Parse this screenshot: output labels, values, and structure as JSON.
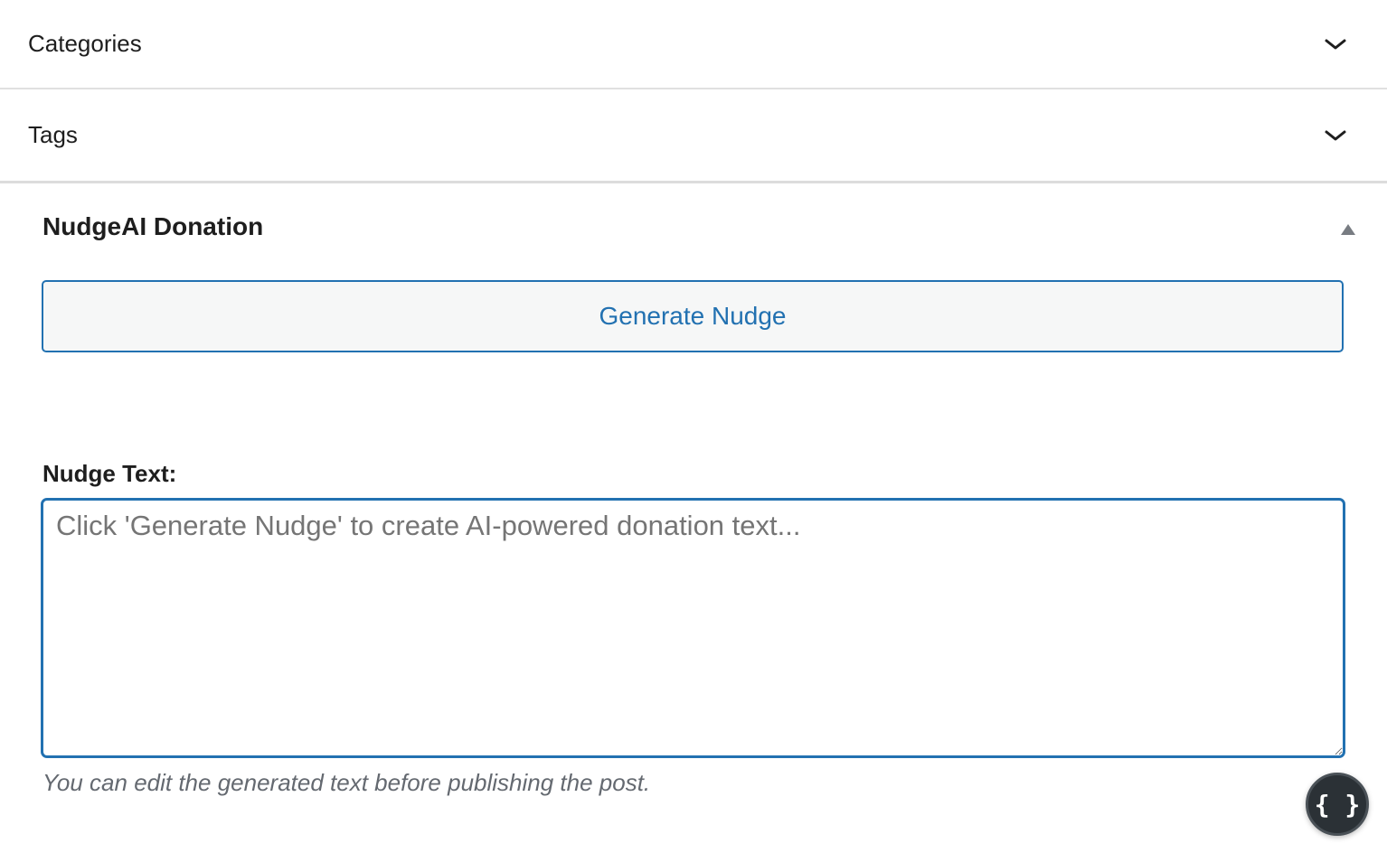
{
  "panels": {
    "categories": {
      "title": "Categories",
      "icon": "chevron-down-icon"
    },
    "tags": {
      "title": "Tags",
      "icon": "chevron-down-icon"
    }
  },
  "nudge_box": {
    "title": "NudgeAI Donation",
    "toggle_icon": "triangle-up-icon",
    "generate_button_label": "Generate Nudge",
    "field_label": "Nudge Text:",
    "textarea_value": "",
    "textarea_placeholder": "Click 'Generate Nudge' to create AI-powered donation text...",
    "help_text": "You can edit the generated text before publishing the post."
  },
  "fab": {
    "label": "{ }",
    "icon": "code-braces-icon"
  },
  "colors": {
    "accent": "#2271b1",
    "text": "#1e1e1e",
    "muted": "#646970",
    "button_bg": "#f6f7f7",
    "fab_bg": "#2b3136"
  }
}
